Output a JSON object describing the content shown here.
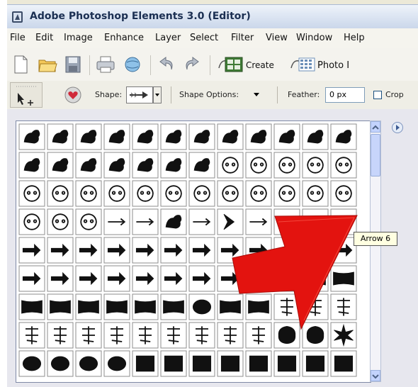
{
  "window": {
    "title": "Adobe Photoshop Elements 3.0 (Editor)"
  },
  "menu": [
    "File",
    "Edit",
    "Image",
    "Enhance",
    "Layer",
    "Select",
    "Filter",
    "View",
    "Window",
    "Help"
  ],
  "toolbar": {
    "create_label": "Create",
    "photo_label": "Photo I"
  },
  "options": {
    "shape_label": "Shape:",
    "shape_options_label": "Shape Options:",
    "feather_label": "Feather:",
    "feather_value": "0 px",
    "crop_label": "Crop"
  },
  "tooltip": {
    "text": "Arrow 6"
  },
  "colors": {
    "annotation_arrow": "#e01010",
    "titlebar": "#c9d6ea",
    "tooltip_bg": "#ffffe1"
  },
  "shapes": [
    [
      "butterfly-1",
      "butterfly-2",
      "snail",
      "fish",
      "rabbit",
      "cat-1",
      "bird-1",
      "cat-2",
      "dog-1",
      "bird-2",
      "bird-3",
      "bird-4"
    ],
    [
      "duck",
      "deer",
      "elephant",
      "dog-2",
      "paw-1",
      "paw-2",
      "bone",
      "frog",
      "fish-outline",
      "face-1",
      "face-2",
      "face-3"
    ],
    [
      "rabbit-face",
      "bunny",
      "puppy",
      "duckling",
      "owl",
      "poodle",
      "pig-face",
      "cat-face-1",
      "dog-face",
      "face-4",
      "pig-face-2",
      "cow-face"
    ],
    [
      "cat-face-2",
      "bear-face",
      "elephant-outline",
      "pencil",
      "tube",
      "fish-2",
      "arrow-sketch",
      "chevron-arrow",
      "arrow-thin",
      "arrow-feather",
      "arrow-line",
      "arrow-6"
    ],
    [
      "arrow-a",
      "arrow-b",
      "arrow-c",
      "arrow-d",
      "arrow-e",
      "arrow-f",
      "arrow-g",
      "arrow-h",
      "arrow-i",
      "arrow-j",
      "arrow-k",
      "arrow-curve"
    ],
    [
      "arrow-turn-1",
      "arrow-turn-2",
      "arrow-m",
      "arrow-n",
      "arrow-o",
      "arrow-wave",
      "arrow-spiral",
      "arrow-turn-3",
      "banner-1",
      "banner-2",
      "banner-3",
      "banner-4"
    ],
    [
      "banner-5",
      "banner-6",
      "scroll",
      "trophy",
      "flag-1",
      "flag-2",
      "seal",
      "ribbon-1",
      "ribbon-2",
      "kanji-1",
      "kanji-2",
      "kanji-3"
    ],
    [
      "kanji-4",
      "kanji-5",
      "kanji-6",
      "kanji-7",
      "kanji-8",
      "kanji-9",
      "kanji-10",
      "kanji-11",
      "kanji-12",
      "blob-1",
      "blob-2",
      "starburst"
    ],
    [
      "circle-frame",
      "oval-1",
      "oval-2",
      "oval-3",
      "rect-1",
      "rect-2",
      "rect-3",
      "rect-4",
      "rect-5",
      "rect-6",
      "rect-7",
      "rect-8"
    ]
  ]
}
